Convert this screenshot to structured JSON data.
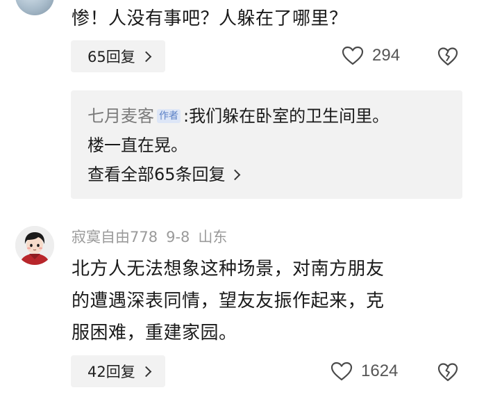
{
  "comment1": {
    "text": "惨！人没有事吧？人躲在了哪里？",
    "reply_button": "65回复",
    "like_count": "294"
  },
  "sub_reply": {
    "author": "七月麦客",
    "author_badge": "作者",
    "separator": ":",
    "text_line1": "我们躲在卧室的卫生间里。",
    "text_line2": "楼一直在晃。",
    "view_all": "查看全部65条回复"
  },
  "comment2": {
    "username": "寂寞自由778",
    "date": "9-8",
    "location": "山东",
    "text_line1": "北方人无法想象这种场景，对南方朋友",
    "text_line2": "的遭遇深表同情，望友友振作起来，克",
    "text_line3": "服困难，重建家园。",
    "reply_button": "42回复",
    "like_count": "1624"
  },
  "icons": {
    "like": "heart-outline-icon",
    "dislike": "broken-heart-icon",
    "chevron": "chevron-right-icon"
  },
  "colors": {
    "text": "#1a1a1a",
    "muted": "#9a9a9a",
    "button_bg": "#f2f2f2",
    "author_badge": "#5b80c6"
  }
}
